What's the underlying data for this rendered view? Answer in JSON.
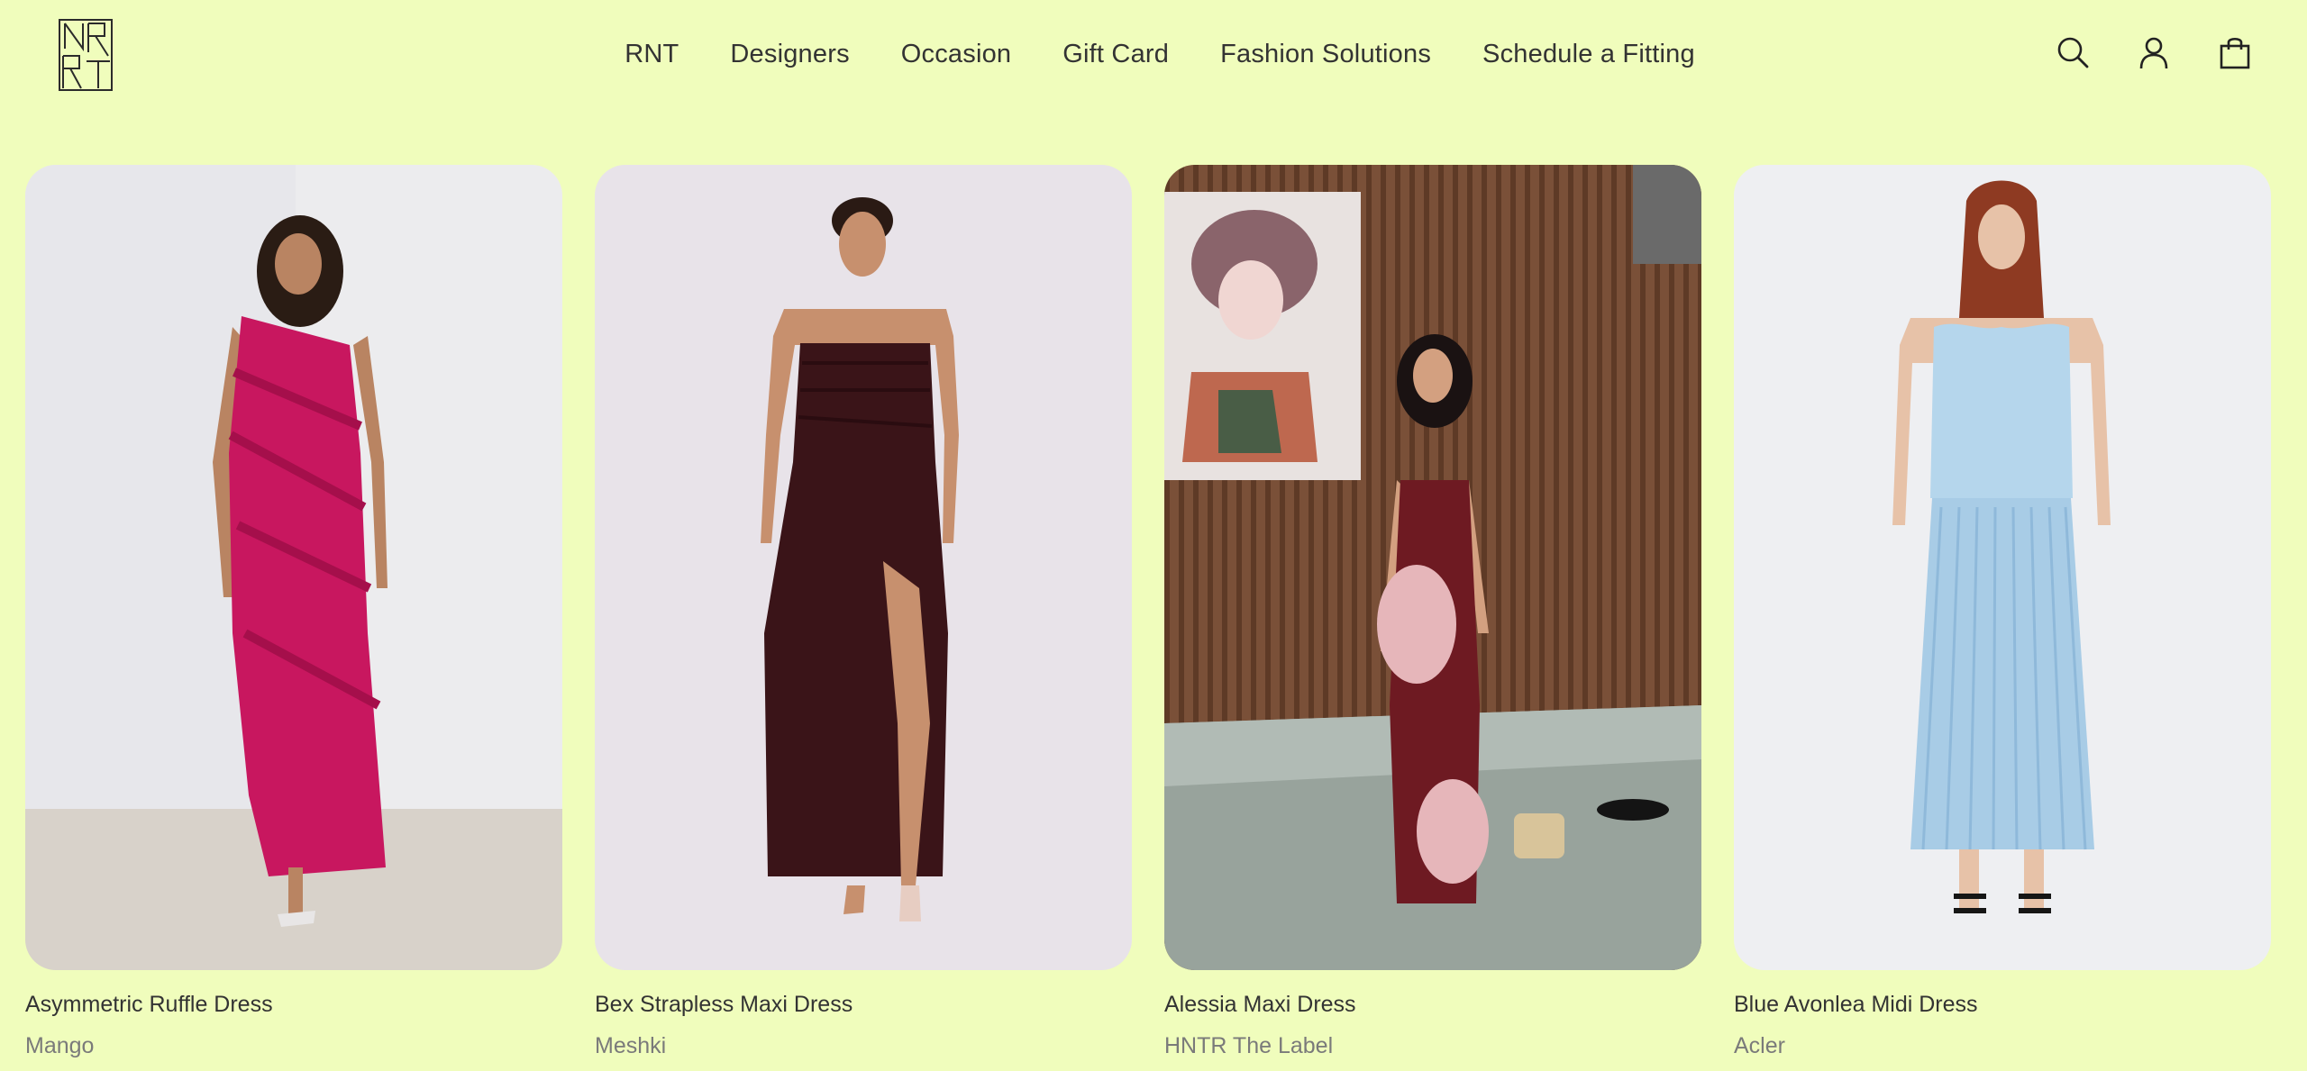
{
  "header": {
    "logo_alt": "RNT",
    "nav": [
      {
        "label": "RNT"
      },
      {
        "label": "Designers"
      },
      {
        "label": "Occasion"
      },
      {
        "label": "Gift Card"
      },
      {
        "label": "Fashion Solutions"
      },
      {
        "label": "Schedule a Fitting"
      }
    ],
    "icons": [
      "search-icon",
      "account-icon",
      "cart-icon"
    ]
  },
  "products": [
    {
      "title": "Asymmetric Ruffle Dress",
      "brand": "Mango",
      "dress_color": "#c8175f",
      "bg": "#eeeef0"
    },
    {
      "title": "Bex Strapless Maxi Dress",
      "brand": "Meshki",
      "dress_color": "#3a1418",
      "bg": "#e8e3e8"
    },
    {
      "title": "Alessia Maxi Dress",
      "brand": "HNTR The Label",
      "dress_color": "#6e1a22",
      "bg": "#7a5038"
    },
    {
      "title": "Blue Avonlea Midi Dress",
      "brand": "Acler",
      "dress_color": "#b5d6ec",
      "bg": "#eeeff2"
    }
  ],
  "colors": {
    "background": "#f0fdbc",
    "text": "#333333",
    "muted": "#7a7a7a"
  }
}
